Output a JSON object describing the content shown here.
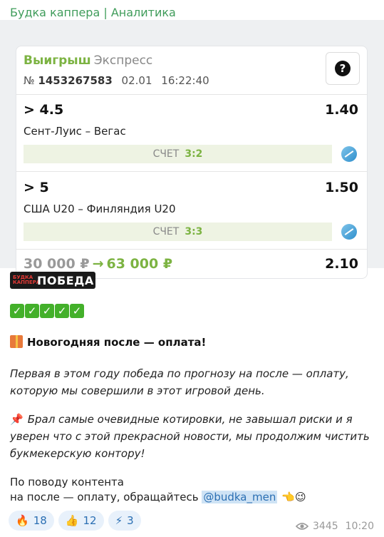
{
  "post": {
    "channel_name": "Будка каппера | Аналитика",
    "bet_card": {
      "result": "Выигрыш",
      "bet_type": "Экспресс",
      "number_label": "№",
      "number": "1453267583",
      "date": "02.01",
      "time": "16:22:40",
      "help_icon": "question-circle-icon",
      "legs": [
        {
          "pick": "> 4.5",
          "odd": "1.40",
          "match": "Сент-Луис – Вегас",
          "score_label": "СЧЕТ",
          "score": "3:2",
          "sport_icon": "hockey-ball-icon"
        },
        {
          "pick": "> 5",
          "odd": "1.50",
          "match": "США U20 – Финляндия U20",
          "score_label": "СЧЕТ",
          "score": "3:3",
          "sport_icon": "hockey-ball-icon"
        }
      ],
      "stake": "30 000 ₽",
      "arrow": "→",
      "payout": "63 000 ₽",
      "total_odd": "2.10"
    },
    "sticker": {
      "small_text": "БУДКА КАППЕРА",
      "big_text": "ПОБЕДА"
    },
    "checkmarks": [
      "✓",
      "✓",
      "✓",
      "✓",
      "✓"
    ],
    "headline": "Новогодняя после — оплата!",
    "paragraph1": "Первая в этом году победа по прогнозу на после — оплату, которую мы совершили в этот игровой день.",
    "paragraph2": "Брал самые очевидные котировки, не завышал риски и я уверен что с этой прекрасной новости, мы продолжим чистить букмекерскую контору!",
    "contact_line1": "По поводу контента",
    "contact_line2": "на после — оплату, обращайтесь",
    "mention": "@budka_men",
    "contact_emoji": "👈😉",
    "reactions": [
      {
        "icon": "🔥",
        "count": "18"
      },
      {
        "icon": "👍",
        "count": "12"
      },
      {
        "icon": "⚡",
        "count": "3"
      }
    ],
    "views": "3445",
    "time": "10:20"
  },
  "colors": {
    "accent_green": "#7cb342",
    "channel_green": "#3f9c5a",
    "link_blue": "#2b6fb3"
  }
}
